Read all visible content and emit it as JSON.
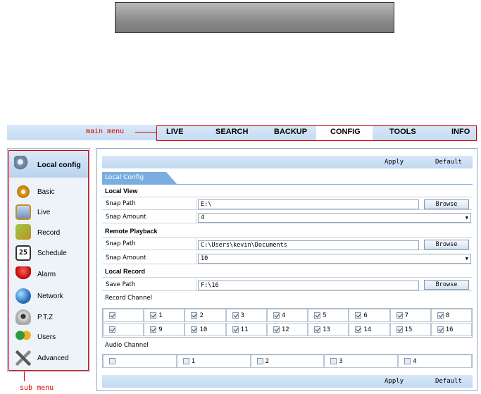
{
  "top_nav": {
    "annotation": "main menu",
    "items": [
      "LIVE",
      "SEARCH",
      "BACKUP",
      "CONFIG",
      "TOOLS",
      "INFO"
    ],
    "active": "CONFIG"
  },
  "sidebar": {
    "annotation": "sub menu",
    "header": {
      "label": "Local config",
      "icon": "gear-icon"
    },
    "items": [
      {
        "label": "Basic",
        "icon": "gear-icon"
      },
      {
        "label": "Live",
        "icon": "monitor-icon"
      },
      {
        "label": "Record",
        "icon": "record-icon"
      },
      {
        "label": "Schedule",
        "icon": "calendar-icon",
        "icon_text": "25"
      },
      {
        "label": "Alarm",
        "icon": "alarm-icon"
      },
      {
        "label": "Network",
        "icon": "globe-icon"
      },
      {
        "label": "P.T.Z",
        "icon": "camera-dome-icon"
      },
      {
        "label": "Users",
        "icon": "users-icon"
      },
      {
        "label": "Advanced",
        "icon": "tools-icon"
      }
    ]
  },
  "toolbar": {
    "apply": "Apply",
    "default": "Default"
  },
  "tab": {
    "label": "Local Config"
  },
  "local_view": {
    "title": "Local View",
    "snap_path": {
      "label": "Snap Path",
      "value": "E:\\",
      "button": "Browse"
    },
    "snap_amount": {
      "label": "Snap Amount",
      "value": "4"
    }
  },
  "remote_playback": {
    "title": "Remote Playback",
    "snap_path": {
      "label": "Snap Path",
      "value": "C:\\Users\\kevin\\Documents",
      "button": "Browse"
    },
    "snap_amount": {
      "label": "Snap Amount",
      "value": "10"
    }
  },
  "local_record": {
    "title": "Local Record",
    "save_path": {
      "label": "Save Path",
      "value": "F:\\16",
      "button": "Browse"
    }
  },
  "record_channel": {
    "title": "Record Channel",
    "rows": [
      [
        "",
        "1",
        "2",
        "3",
        "4",
        "5",
        "6",
        "7",
        "8"
      ],
      [
        "",
        "9",
        "10",
        "11",
        "12",
        "13",
        "14",
        "15",
        "16"
      ]
    ],
    "checked": true
  },
  "audio_channel": {
    "title": "Audio Channel",
    "items": [
      "",
      "1",
      "2",
      "3",
      "4"
    ],
    "checked": false
  },
  "colors": {
    "accent": "#7aaee0",
    "annotation": "#dd0000",
    "bar": "#c6dcf2"
  }
}
